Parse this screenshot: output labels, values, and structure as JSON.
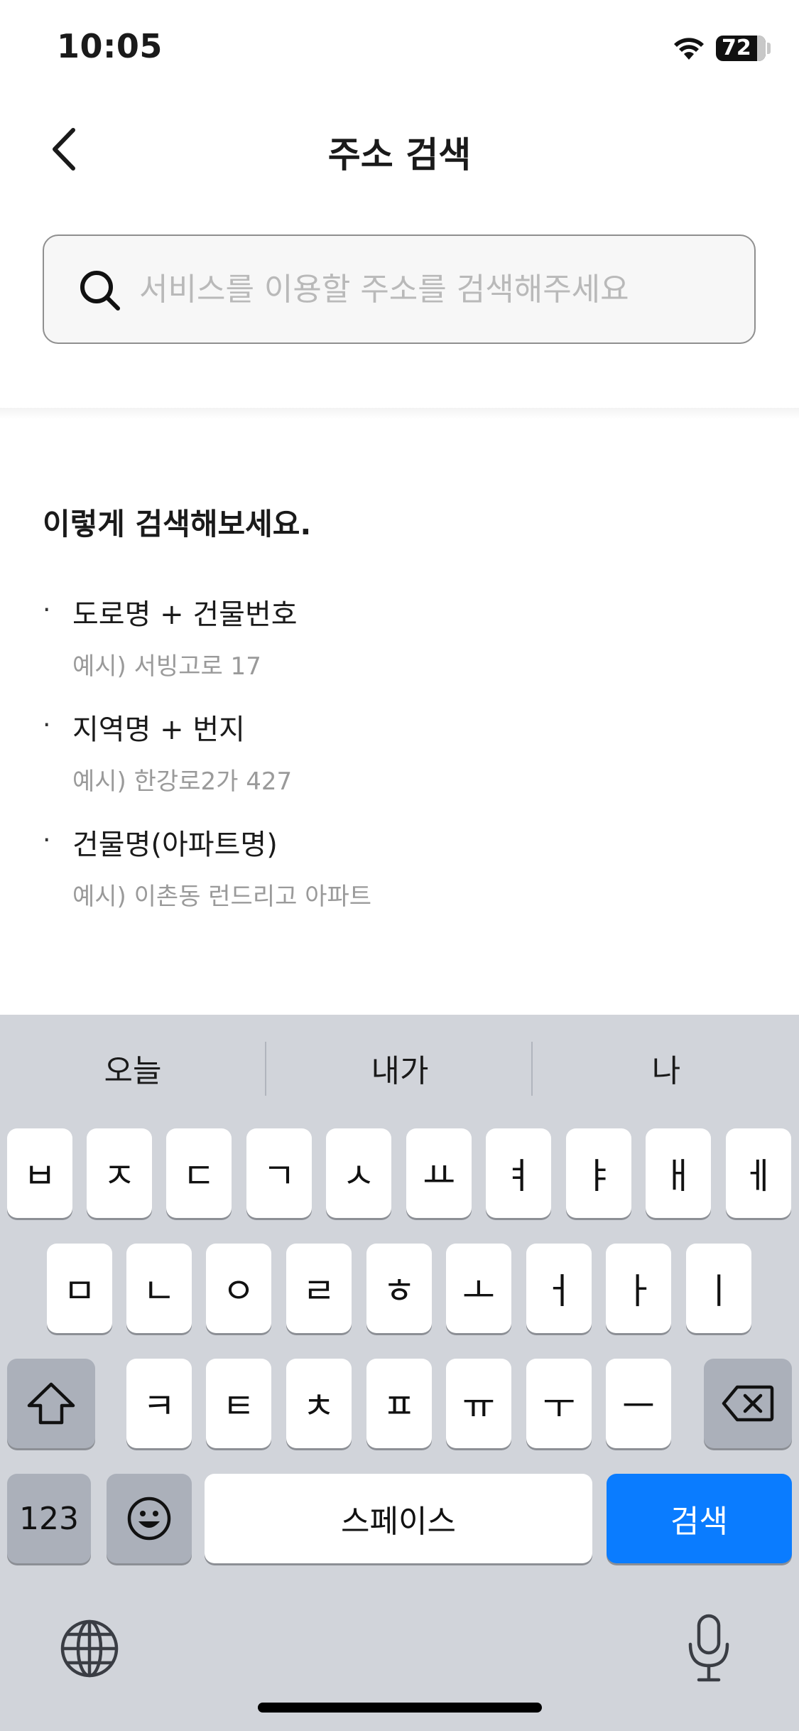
{
  "status_bar": {
    "time": "10:05",
    "battery": "72",
    "wifi_icon": "wifi-icon"
  },
  "nav": {
    "title": "주소 검색",
    "back_icon": "chevron-left-icon"
  },
  "search": {
    "placeholder": "서비스를 이용할 주소를 검색해주세요",
    "value": ""
  },
  "tips": {
    "title": "이렇게 검색해보세요.",
    "items": [
      {
        "bullet": "·",
        "label": "도로명 + 건물번호",
        "example": "예시) 서빙고로 17"
      },
      {
        "bullet": "·",
        "label": "지역명 + 번지",
        "example": "예시) 한강로2가 427"
      },
      {
        "bullet": "·",
        "label": "건물명(아파트명)",
        "example": "예시) 이촌동 런드리고 아파트"
      }
    ]
  },
  "keyboard": {
    "suggestions": [
      "오늘",
      "내가",
      "나"
    ],
    "row1": [
      "ㅂ",
      "ㅈ",
      "ㄷ",
      "ㄱ",
      "ㅅ",
      "ㅛ",
      "ㅕ",
      "ㅑ",
      "ㅐ",
      "ㅔ"
    ],
    "row2": [
      "ㅁ",
      "ㄴ",
      "ㅇ",
      "ㄹ",
      "ㅎ",
      "ㅗ",
      "ㅓ",
      "ㅏ",
      "ㅣ"
    ],
    "row3": [
      "ㅋ",
      "ㅌ",
      "ㅊ",
      "ㅍ",
      "ㅠ",
      "ㅜ",
      "ㅡ"
    ],
    "numbers_label": "123",
    "space_label": "스페이스",
    "search_label": "검색",
    "accent_color": "#0a7cff"
  }
}
